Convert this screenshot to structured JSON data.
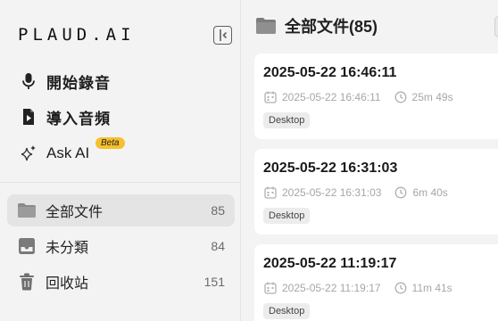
{
  "sidebar": {
    "logo": "PLAUD.AI",
    "actions": [
      {
        "label": "開始錄音",
        "icon": "microphone-icon"
      },
      {
        "label": "導入音頻",
        "icon": "import-audio-icon"
      },
      {
        "label": "Ask AI",
        "icon": "sparkle-icon",
        "badge": "Beta"
      }
    ],
    "nav": [
      {
        "label": "全部文件",
        "count": "85",
        "icon": "folder-icon",
        "active": true
      },
      {
        "label": "未分類",
        "count": "84",
        "icon": "inbox-icon",
        "active": false
      },
      {
        "label": "回收站",
        "count": "151",
        "icon": "trash-icon",
        "active": false
      }
    ]
  },
  "main": {
    "title": "全部文件(85)",
    "files": [
      {
        "title": "2025-05-22 16:46:11",
        "date": "2025-05-22 16:46:11",
        "duration": "25m 49s",
        "tag": "Desktop"
      },
      {
        "title": "2025-05-22 16:31:03",
        "date": "2025-05-22 16:31:03",
        "duration": "6m 40s",
        "tag": "Desktop"
      },
      {
        "title": "2025-05-22 11:19:17",
        "date": "2025-05-22 11:19:17",
        "duration": "11m 41s",
        "tag": "Desktop"
      }
    ]
  },
  "colors": {
    "background": "#f3f3f3",
    "active_nav": "#e4e4e4",
    "card": "#ffffff",
    "beta_badge": "#f6c02c",
    "meta_text": "#a6a6a6"
  }
}
